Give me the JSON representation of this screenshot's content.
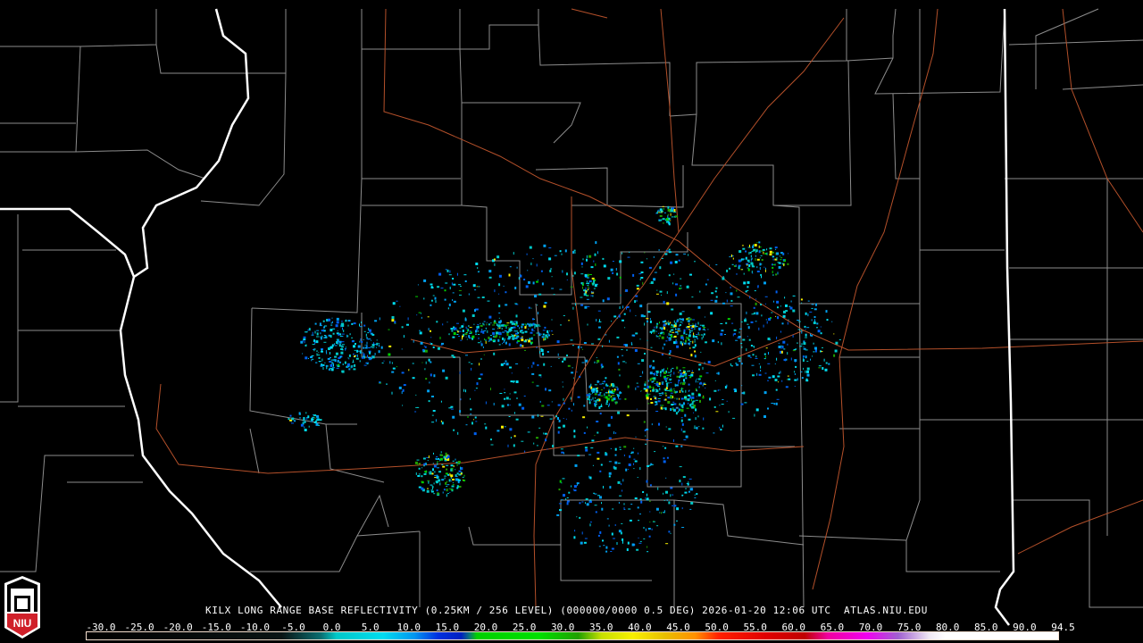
{
  "product_title": "KILX LONG RANGE BASE REFLECTIVITY (0.25KM / 256 LEVEL) (000000/0000 0.5 DEG) 2026-01-20 12:06 UTC  ATLAS.NIU.EDU",
  "logo_text": "NIU",
  "colorbar": {
    "labels": [
      "-30.0",
      "-25.0",
      "-20.0",
      "-15.0",
      "-10.0",
      "-5.0",
      "0.0",
      "5.0",
      "10.0",
      "15.0",
      "20.0",
      "25.0",
      "30.0",
      "35.0",
      "40.0",
      "45.0",
      "50.0",
      "55.0",
      "60.0",
      "65.0",
      "70.0",
      "75.0",
      "80.0",
      "85.0",
      "90.0",
      "94.5"
    ],
    "min": -30,
    "max": 94.5,
    "stops": [
      {
        "v": -30,
        "c": "#000000"
      },
      {
        "v": -5,
        "c": "#0a1414"
      },
      {
        "v": 0,
        "c": "#0a6e70"
      },
      {
        "v": 2,
        "c": "#00c8c8"
      },
      {
        "v": 8,
        "c": "#00dcf0"
      },
      {
        "v": 12,
        "c": "#0096f0"
      },
      {
        "v": 15,
        "c": "#0030e0"
      },
      {
        "v": 18,
        "c": "#0020c0"
      },
      {
        "v": 19,
        "c": "#0a7080"
      },
      {
        "v": 20,
        "c": "#00d000"
      },
      {
        "v": 28,
        "c": "#00e000"
      },
      {
        "v": 33,
        "c": "#20a000"
      },
      {
        "v": 36,
        "c": "#c8e000"
      },
      {
        "v": 40,
        "c": "#f8f000"
      },
      {
        "v": 44,
        "c": "#e8c000"
      },
      {
        "v": 48,
        "c": "#ff9000"
      },
      {
        "v": 51,
        "c": "#ff2000"
      },
      {
        "v": 57,
        "c": "#e00000"
      },
      {
        "v": 62,
        "c": "#c00000"
      },
      {
        "v": 65,
        "c": "#f000a0"
      },
      {
        "v": 70,
        "c": "#f000f0"
      },
      {
        "v": 74,
        "c": "#a060d0"
      },
      {
        "v": 78,
        "c": "#f0e8f4"
      },
      {
        "v": 80,
        "c": "#ffffff"
      },
      {
        "v": 94.5,
        "c": "#ffffff"
      }
    ]
  },
  "colors": {
    "state_border": "#ffffff",
    "county_border": "#8c8c8c",
    "highway": "#b4502a",
    "background": "#000000",
    "logo_red": "#d0202a"
  }
}
